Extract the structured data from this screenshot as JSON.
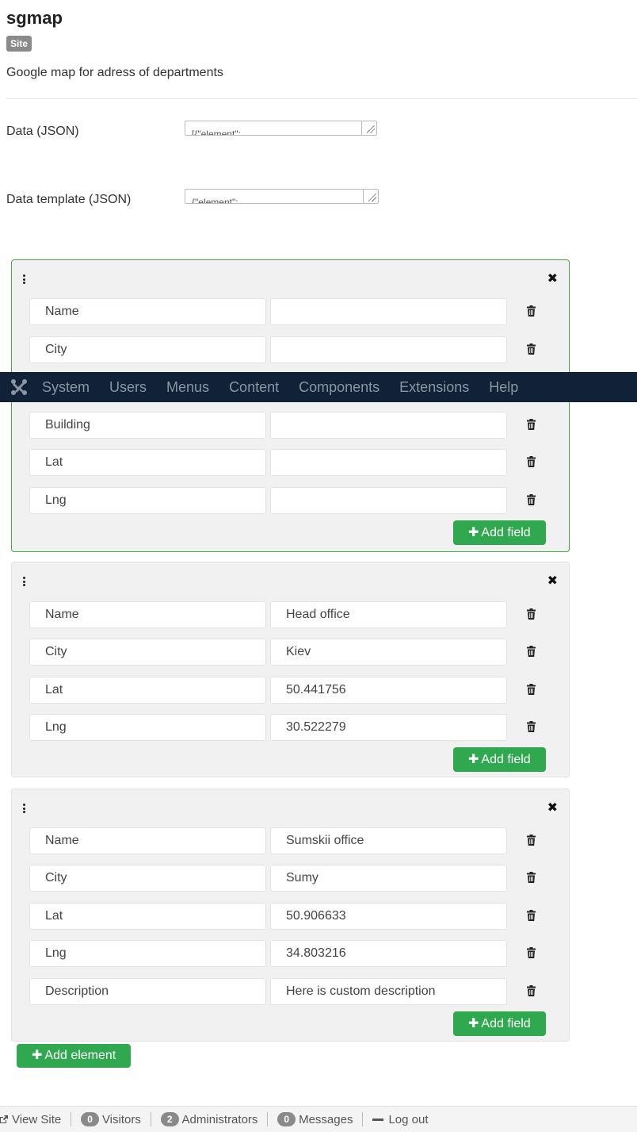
{
  "page": {
    "title": "sgmap",
    "badge": "Site",
    "description": "Google map for adress of departments"
  },
  "form": {
    "data_label": "Data (JSON)",
    "data_value": "[{\"element\":",
    "template_label": "Data template (JSON)",
    "template_value": "{\"element\":"
  },
  "navbar": {
    "items": [
      "System",
      "Users",
      "Menus",
      "Content",
      "Components",
      "Extensions",
      "Help"
    ],
    "background": "#112238"
  },
  "elements": [
    {
      "fields": [
        {
          "key": "Name",
          "value": ""
        },
        {
          "key": "City",
          "value": ""
        },
        {
          "key": "Building",
          "value": ""
        },
        {
          "key": "Lat",
          "value": ""
        },
        {
          "key": "Lng",
          "value": ""
        }
      ],
      "add_field_label": "Add field"
    },
    {
      "fields": [
        {
          "key": "Name",
          "value": "Head office"
        },
        {
          "key": "City",
          "value": "Kiev"
        },
        {
          "key": "Lat",
          "value": "50.441756"
        },
        {
          "key": "Lng",
          "value": "30.522279"
        }
      ],
      "add_field_label": "Add field"
    },
    {
      "fields": [
        {
          "key": "Name",
          "value": "Sumskii office"
        },
        {
          "key": "City",
          "value": "Sumy"
        },
        {
          "key": "Lat",
          "value": "50.906633"
        },
        {
          "key": "Lng",
          "value": "34.803216"
        },
        {
          "key": "Description",
          "value": "Here is custom description"
        }
      ],
      "add_field_label": "Add field"
    }
  ],
  "add_element_label": "Add element",
  "statusbar": {
    "view_site": "View Site",
    "visitors_count": "0",
    "visitors_label": "Visitors",
    "admins_count": "2",
    "admins_label": "Administrators",
    "messages_count": "0",
    "messages_label": "Messages",
    "logout": "Log out"
  },
  "colors": {
    "accent_green": "#2fa84f",
    "active_border": "#46a546",
    "badge_gray": "#8a8a8a"
  },
  "icons": [
    "joomla-logo-icon",
    "drag-handle-icon",
    "close-icon",
    "trash-icon",
    "plus-icon",
    "external-link-icon",
    "minus-icon"
  ]
}
